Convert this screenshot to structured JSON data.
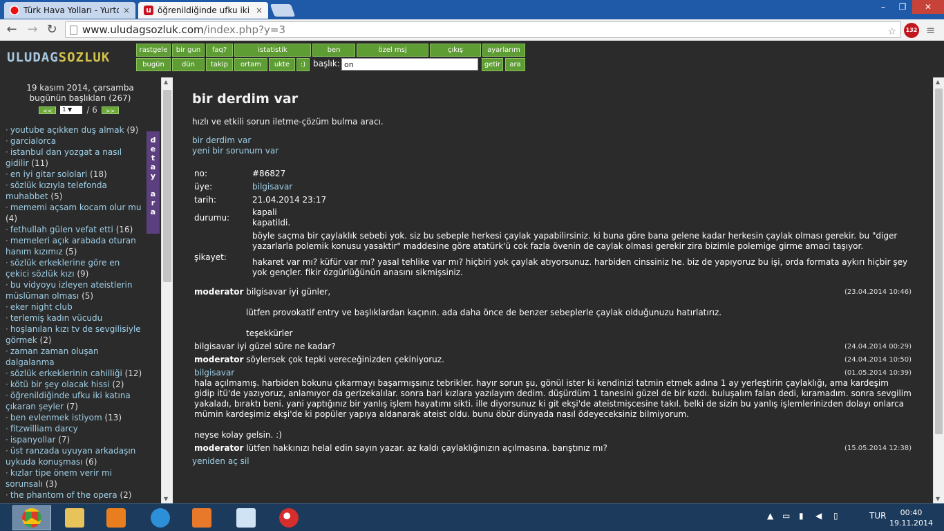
{
  "browser": {
    "tabs": [
      {
        "title": "Türk Hava Yolları - Yurtdış",
        "close": "×"
      },
      {
        "title": "öğrenildiğinde ufku iki katı",
        "close": "×"
      }
    ],
    "url_host": "www.uludagsozluk.com",
    "url_path": "/index.php?y=3",
    "abp_count": "132"
  },
  "site": {
    "logo_part1": "ULUDAG",
    "logo_part2": "SOZLUK",
    "nav_row1": [
      "rastgele",
      "bir gun",
      "faq?",
      "istatistik",
      "ben",
      "özel msj",
      "çıkış",
      "ayarlarım"
    ],
    "nav_row2": [
      "bugün",
      "dün",
      "takip",
      "ortam",
      "ukte",
      ":)"
    ],
    "baslik_label": "başlık:",
    "baslik_value": "on",
    "getir": "getir",
    "ara": "ara"
  },
  "sidebar": {
    "date": "19 kasım 2014, çarsamba",
    "today_topics": "bugünün başlıkları (267)",
    "prev": "<<",
    "next": ">>",
    "page": "1",
    "page_total": "/ 6",
    "detay_ara": "d e t a y  a r a",
    "topics": [
      {
        "text": "youtube açıkken duş almak",
        "count": "(9)"
      },
      {
        "text": "garcialorca",
        "count": ""
      },
      {
        "text": "istanbul dan yozgat a nasıl gidilir",
        "count": "(11)"
      },
      {
        "text": "en iyi gitar sololari",
        "count": "(18)"
      },
      {
        "text": "sözlük kızıyla telefonda muhabbet",
        "count": "(5)"
      },
      {
        "text": "mememi açsam kocam olur mu",
        "count": "(4)"
      },
      {
        "text": "fethullah gülen vefat etti",
        "count": "(16)"
      },
      {
        "text": "memeleri açık arabada oturan hanım kızımız",
        "count": "(5)"
      },
      {
        "text": "sözlük erkeklerine göre en çekici sözlük kızı",
        "count": "(9)"
      },
      {
        "text": "bu vidyoyu izleyen ateistlerin müslüman olması",
        "count": "(5)"
      },
      {
        "text": "eker night club",
        "count": ""
      },
      {
        "text": "terlemiş kadın vücudu",
        "count": ""
      },
      {
        "text": "hoşlanılan kızı tv de sevgilisiyle görmek",
        "count": "(2)"
      },
      {
        "text": "zaman zaman oluşan dalgalanma",
        "count": ""
      },
      {
        "text": "sözlük erkeklerinin cahilliği",
        "count": "(12)"
      },
      {
        "text": "kötü bir şey olacak hissi",
        "count": "(2)"
      },
      {
        "text": "öğrenildiğinde ufku iki katına çıkaran şeyler",
        "count": "(7)"
      },
      {
        "text": "ben evlenmek istiyom",
        "count": "(13)"
      },
      {
        "text": "fitzwilliam darcy",
        "count": ""
      },
      {
        "text": "ispanyollar",
        "count": "(7)"
      },
      {
        "text": "üst ranzada uyuyan arkadaşın uykuda konuşması",
        "count": "(6)"
      },
      {
        "text": "kızlar tipe önem verir mi sorunsalı",
        "count": "(3)"
      },
      {
        "text": "the phantom of the opera",
        "count": "(2)"
      }
    ]
  },
  "main": {
    "title": "bir derdim var",
    "subtitle": "hızlı ve etkili sorun iletme-çözüm bulma aracı.",
    "link1": "bir derdim var",
    "link2": "yeni bir sorunum var",
    "labels": {
      "no": "no:",
      "uye": "üye:",
      "tarih": "tarih:",
      "durumu": "durumu:",
      "sikayet": "şikayet:"
    },
    "no": "#86827",
    "uye": "bilgisavar",
    "tarih": "21.04.2014 23:17",
    "durum1": "kapali",
    "durum2": "kapatildi.",
    "sikayet_p1": "böyle saçma bir çaylaklık sebebi yok. siz bu sebeple herkesi çaylak yapabilirsiniz. ki buna göre bana gelene kadar herkesin çaylak olması gerekir. bu \"diger yazarlarla polemik konusu yasaktir\" maddesine göre atatürk'ü cok fazla övenin de caylak olmasi gerekir zira bizimle polemige girme amaci taşıyor.",
    "sikayet_p2": "hakaret var mı? küfür var mı? yasal tehlike var mı? hiçbiri yok çaylak atıyorsunuz. harbiden cinssiniz he. biz de yapıyoruz bu işi, orda formata aykırı hiçbir şey yok gençler. fikir özgürlüğünün anasını sikmişsiniz.",
    "posts": [
      {
        "who": "moderator",
        "lines": [
          "bilgisavar iyi günler,",
          "",
          "lütfen provokatif entry ve başlıklardan kaçının. ada daha önce de benzer sebeplerle çaylak olduğunuzu hatırlatırız.",
          "",
          "teşekkürler"
        ],
        "date": "(23.04.2014 10:46)"
      },
      {
        "who": "bilgisavar",
        "text": "iyi güzel süre ne kadar?",
        "date": "(24.04.2014 00:29)"
      },
      {
        "who": "moderator",
        "text": "söylersek çok tepki vereceğinizden çekiniyoruz.",
        "date": "(24.04.2014 10:50)"
      },
      {
        "who": "bilgisavar",
        "text": "hala açılmamış. harbiden bokunu çıkarmayı başarmışsınız tebrikler. hayır sorun şu, gönül ister ki kendinizi tatmin etmek adına 1 ay yerleştirin çaylaklığı, ama kardeşim gidip itü'de yazıyoruz, anlamıyor da gerizekalılar. sonra bari kızlara yazılayım dedim. düşürdüm 1 tanesini güzel de bir kızdı. buluşalım falan dedi, kıramadım. sonra sevgilim yakaladı, bıraktı beni. yani yaptığınız bir yanlış işlem hayatımı sikti. ille diyorsunuz ki git ekşi'de ateistmişcesine takıl. belki de sizin bu yanlış işlemlerinizden dolayı onlarca mümin kardeşimiz ekşi'de ki popüler yapıya aldanarak ateist oldu. bunu öbür dünyada nasıl ödeyeceksiniz bilmiyorum.",
        "text2": "neyse kolay gelsin. :)",
        "date": "(01.05.2014 10:39)"
      },
      {
        "who": "moderator",
        "text": "lütfen hakkınızı helal edin sayın yazar. az kaldı çaylaklığınızın açılmasına. barıştınız mı?",
        "date": "(15.05.2014 12:38)"
      }
    ],
    "reopen": "yeniden aç sil"
  },
  "taskbar": {
    "lang": "TUR",
    "time": "00:40",
    "date": "19.11.2014"
  }
}
